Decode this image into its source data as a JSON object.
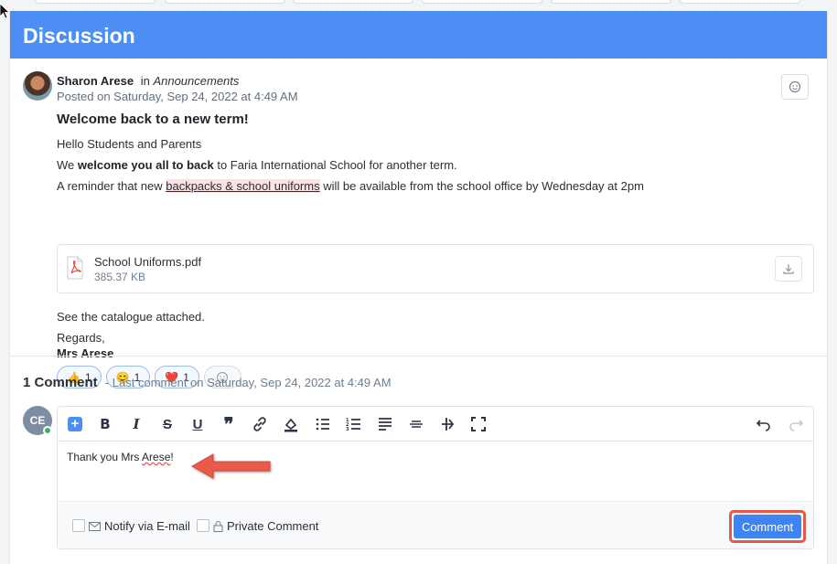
{
  "header": {
    "title": "Discussion"
  },
  "post": {
    "author": "Sharon Arese",
    "in_word": "in",
    "channel": "Announcements",
    "posted": "Posted on Saturday, Sep 24, 2022 at 4:49 AM",
    "title": "Welcome back to a new term!",
    "greeting": "Hello Students and Parents",
    "line2_pre": "We ",
    "line2_bold": "welcome you all to back",
    "line2_post": " to Faria International School for another term.",
    "line3_pre": "A reminder that new ",
    "line3_link": "backpacks & school uniforms",
    "line3_post": " will be available from the school office by Wednesday at 2pm",
    "attachment": {
      "name": "School Uniforms.pdf",
      "size": "385.37 KB"
    },
    "catalogue": "See the catalogue attached.",
    "regards": "Regards,",
    "signature": "Mrs Arese",
    "reactions": [
      {
        "emoji": "👍",
        "count": "1"
      },
      {
        "emoji": "😊",
        "count": "1"
      },
      {
        "emoji": "❤️",
        "count": "1"
      }
    ]
  },
  "comments": {
    "count_label": "1 Comment",
    "last_label": "- Last comment on Saturday, Sep 24, 2022 at 4:49 AM",
    "avatar_initials": "CE",
    "draft_text_pre": "Thank you Mrs ",
    "draft_text_spell": "Arese",
    "draft_text_post": "!",
    "notify_label": "Notify via E-mail",
    "private_label": "Private Comment",
    "submit_label": "Comment"
  },
  "colors": {
    "header_bg": "#4d8ef5",
    "submit_bg": "#3f84f3",
    "highlight_outline": "#e25a4a"
  }
}
